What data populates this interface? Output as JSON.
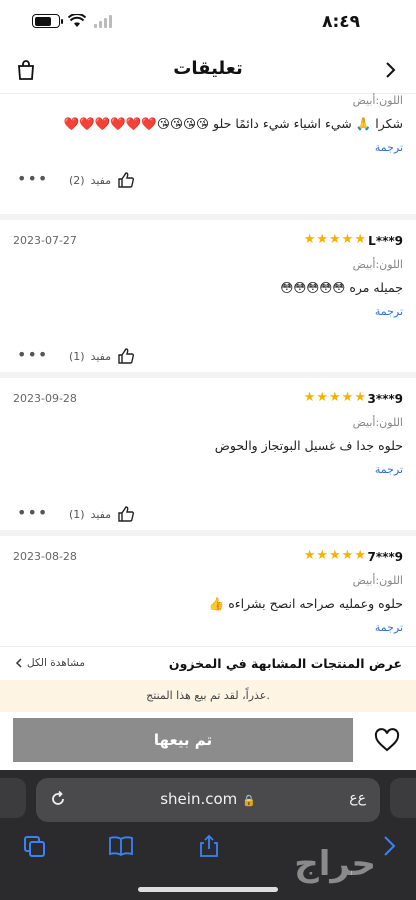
{
  "status": {
    "time": "٨:٤٩"
  },
  "header": {
    "title": "تعليقات"
  },
  "reviews": [
    {
      "reviewer": "",
      "date": "",
      "color": "اللون:أبيض",
      "text": "شكرا 🙏 شيء اشياء شيء دائمًا حلو 😘😘😘😘❤️❤️❤️❤️❤️❤️",
      "translate": "ترجمة",
      "helpful_label": "مفيد",
      "helpful_count": "(2)"
    },
    {
      "reviewer": "L***9",
      "date": "2023-07-27",
      "color": "اللون:أبيض",
      "text": "جميله مره 😳😳😳😳😳",
      "translate": "ترجمة",
      "helpful_label": "مفيد",
      "helpful_count": "(1)"
    },
    {
      "reviewer": "3***9",
      "date": "2023-09-28",
      "color": "اللون:أبيض",
      "text": "حلوه جدا ف غسيل البوتجاز والحوض",
      "translate": "ترجمة",
      "helpful_label": "مفيد",
      "helpful_count": "(1)"
    },
    {
      "reviewer": "7***9",
      "date": "2023-08-28",
      "color": "اللون:أبيض",
      "text": "حلوه وعمليه صراحه انصح بشراءه 👍",
      "translate": "ترجمة"
    }
  ],
  "stars": "★★★★★",
  "similar": {
    "title": "عرض المنتجات المشابهة في المخزون",
    "view_all": "مشاهدة الكل"
  },
  "notice": {
    "text": "عذراً، لقد تم بيع هذا المنتج."
  },
  "action": {
    "sold_label": "تم بيعها"
  },
  "browser": {
    "url": "shein.com",
    "aa": "ع‌ع"
  },
  "watermark": "حراج",
  "colors": {
    "accent_link": "#2a6fd6",
    "star": "#f5b301",
    "sold_button": "#8c8c8c",
    "notice_bg": "#fdf4e3"
  }
}
